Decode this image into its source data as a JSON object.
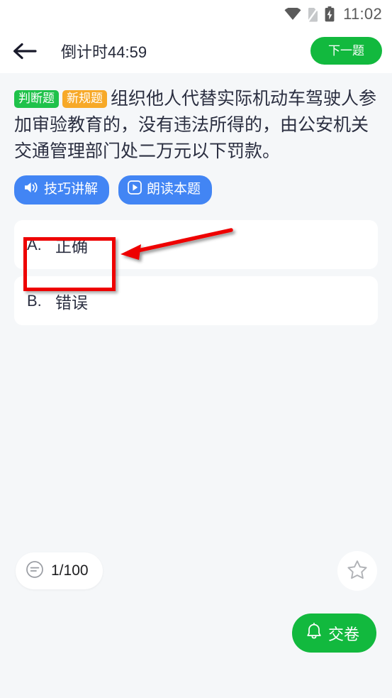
{
  "status_bar": {
    "time": "11:02",
    "icons": [
      "wifi-icon",
      "no-sim-icon",
      "battery-charging-icon"
    ]
  },
  "header": {
    "back_icon": "back-arrow-icon",
    "title": "倒计时44:59",
    "next_label": "下一题"
  },
  "question": {
    "tags": [
      {
        "label": "判断题",
        "color": "#1fc24a"
      },
      {
        "label": "新规题",
        "color": "#f7a928"
      }
    ],
    "text": "组织他人代替实际机动车驾驶人参加审验教育的，没有违法所得的，由公安机关交通管理部门处二万元以下罚款。",
    "actions": [
      {
        "label": "技巧讲解",
        "icon": "speaker-icon"
      },
      {
        "label": "朗读本题",
        "icon": "play-icon"
      }
    ]
  },
  "options": [
    {
      "letter": "A.",
      "text": "正确",
      "highlighted": true
    },
    {
      "letter": "B.",
      "text": "错误",
      "highlighted": false
    }
  ],
  "bottom": {
    "sheet_icon": "answer-sheet-icon",
    "progress": "1/100",
    "favorite_icon": "star-outline-icon",
    "submit_label": "交卷",
    "submit_icon": "bell-icon"
  },
  "annotation": {
    "type": "red-box-arrow",
    "color": "#ee0000",
    "target": "正确"
  },
  "theme": {
    "brand_green": "#12b93e",
    "action_blue": "#4285f4",
    "page_bg": "#f5f7f9",
    "card_bg": "#ffffff",
    "text_dark": "#2b2f41"
  }
}
